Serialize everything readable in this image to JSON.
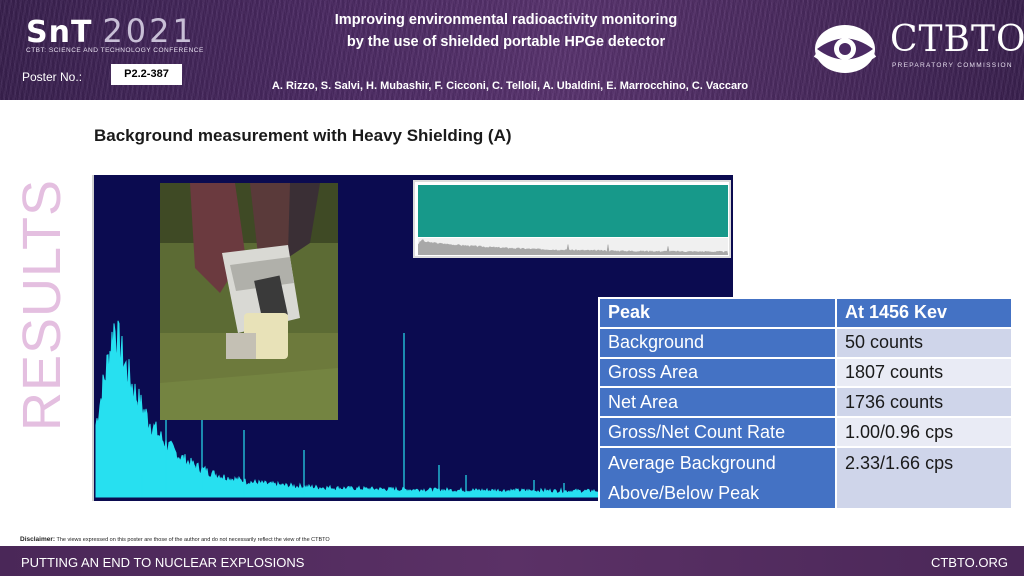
{
  "header": {
    "snt_main": "SnT",
    "snt_year": "2021",
    "snt_subtitle": "CTBT: SCIENCE AND TECHNOLOGY CONFERENCE",
    "poster_label": "Poster No.:",
    "poster_number": "P2.2-387",
    "title_line1": "Improving environmental radioactivity monitoring",
    "title_line2": "by the use of shielded portable HPGe detector",
    "authors": "A. Rizzo, S. Salvi, H. Mubashir, F. Cicconi, C. Telloli, A. Ubaldini, E. Marrocchino, C. Vaccaro",
    "org_name": "CTBTO",
    "org_subtitle": "PREPARATORY COMMISSION"
  },
  "side_label": "RESULTS",
  "section_title": "Background measurement with Heavy Shielding (A)",
  "table": {
    "header": {
      "key": "Peak",
      "value": "At 1456 Kev"
    },
    "rows": [
      {
        "key": "Background",
        "value": "50 counts"
      },
      {
        "key": "Gross Area",
        "value": "1807 counts"
      },
      {
        "key": "Net Area",
        "value": "1736 counts"
      },
      {
        "key": "Gross/Net Count Rate",
        "value": "1.00/0.96 cps"
      },
      {
        "key_line1": "Average Background",
        "key_line2": "Above/Below Peak",
        "value": "2.33/1.66 cps"
      }
    ]
  },
  "disclaimer": {
    "label": "Disclaimer:",
    "text": "The views expressed on this poster are those of the author and do not necessarily reflect the view of the CTBTO"
  },
  "footer": {
    "left": "PUTTING AN END TO NUCLEAR EXPLOSIONS",
    "right": "CTBTO.ORG"
  },
  "colors": {
    "header_bg": "#4b2a63",
    "spectrum_bg": "#0b0b50",
    "spectrum_trace": "#27e0f0",
    "table_blue": "#4472c4",
    "results_pink": "#e4bfe0"
  }
}
